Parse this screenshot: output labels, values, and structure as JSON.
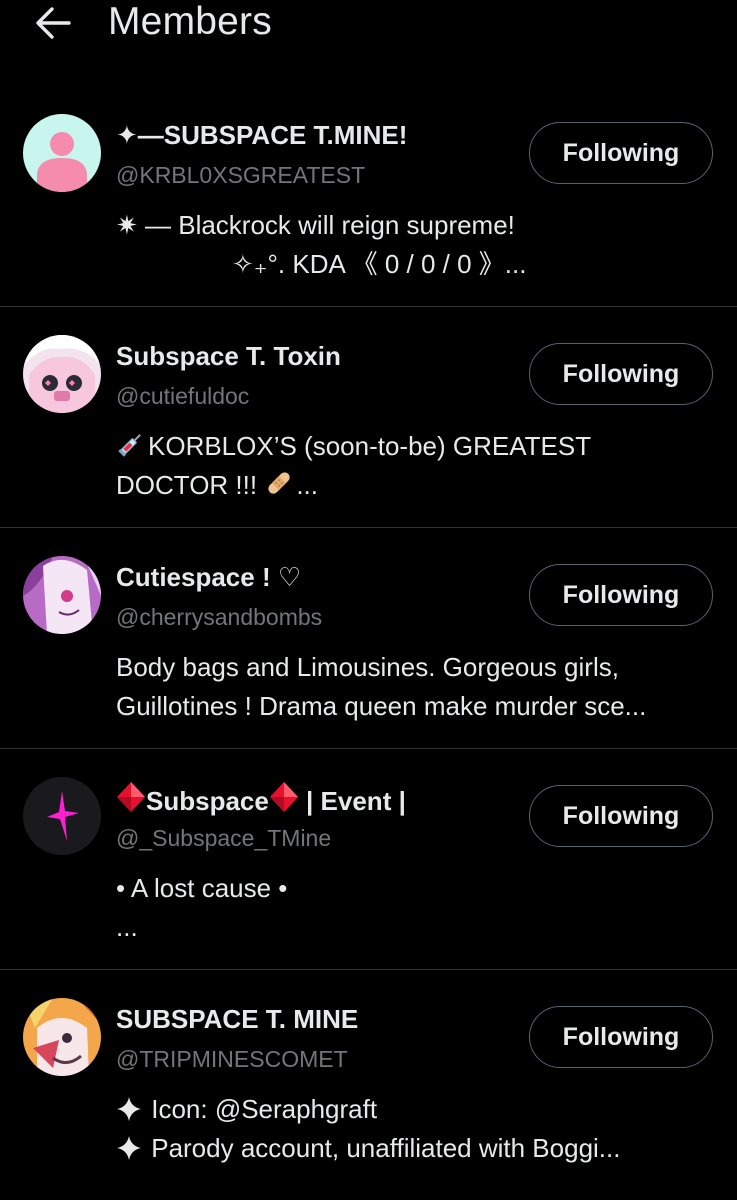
{
  "header": {
    "title": "Members",
    "back_icon": "arrow-left-icon"
  },
  "members": [
    {
      "name": "✦—SUBSPACE T.MINE!",
      "handle": "@KRBL0XSGREATEST",
      "follow_label": "Following",
      "bio_line1": "✷ — Blackrock will reign supreme!",
      "bio_line2": "✧₊°. KDA 《 0 / 0 / 0 》...",
      "avatar": "default-avatar-icon"
    },
    {
      "name": "Subspace T. Toxin",
      "handle": "@cutiefuldoc",
      "follow_label": "Following",
      "bio_line1": "KORBLOX’S (soon-to-be) GREATEST",
      "bio_line2": "DOCTOR !!! ",
      "bio_line2_end": "...",
      "avatar": "character-avatar-pink"
    },
    {
      "name": "Cutiespace ! ♡",
      "handle": "@cherrysandbombs",
      "follow_label": "Following",
      "bio_line1": "Body bags and Limousines. Gorgeous girls,",
      "bio_line2": "Guillotines ! Drama queen make murder sce...",
      "avatar": "character-avatar-purple"
    },
    {
      "name_part1": "Subspace",
      "name_part2": " | Event |",
      "handle": "@_Subspace_TMine",
      "follow_label": "Following",
      "bio_line1": "• A lost cause •",
      "bio_line2": "...",
      "avatar": "dark-avatar-magenta-spark"
    },
    {
      "name": "SUBSPACE T. MINE",
      "handle": "@TRIPMINESCOMET",
      "follow_label": "Following",
      "bio_line1": " Icon: @Seraphgraft",
      "bio_line2": " Parody account, unaffiliated with Boggi...",
      "avatar": "character-avatar-orange"
    }
  ],
  "colors": {
    "background": "#000000",
    "text_primary": "#e7e9ea",
    "text_secondary": "#71767b",
    "divider": "#2f3336",
    "button_border": "#536471"
  }
}
